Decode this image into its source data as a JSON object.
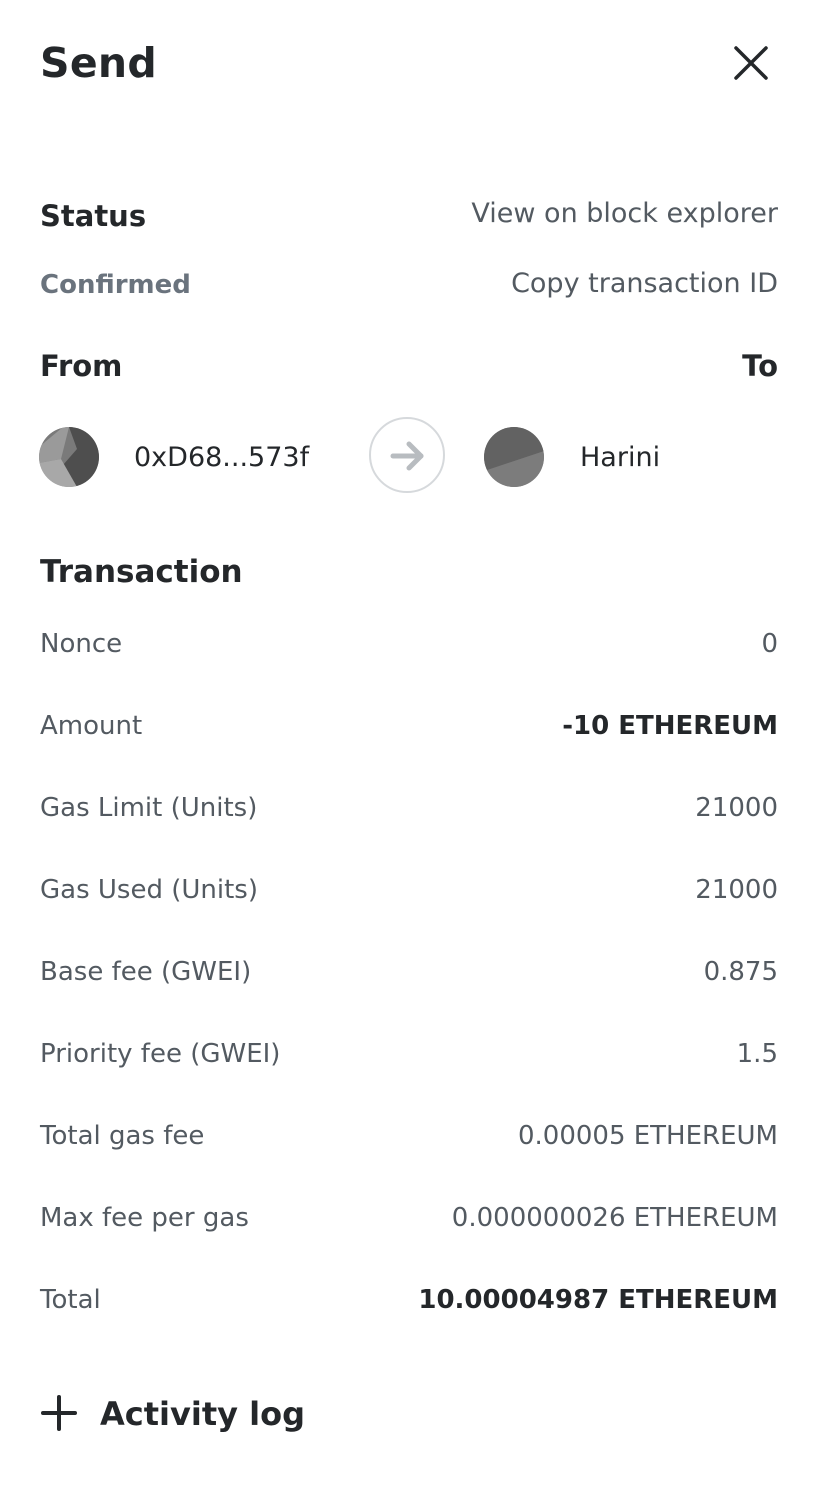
{
  "header": {
    "title": "Send"
  },
  "status": {
    "label": "Status",
    "value": "Confirmed",
    "view_explorer": "View on block explorer",
    "copy_tx_id": "Copy transaction ID"
  },
  "parties": {
    "from_label": "From",
    "to_label": "To",
    "from_address": "0xD68...573f",
    "to_name": "Harini"
  },
  "transaction": {
    "title": "Transaction",
    "rows": [
      {
        "label": "Nonce",
        "value": "0"
      },
      {
        "label": "Amount",
        "value": "-10 ETHEREUM"
      },
      {
        "label": "Gas Limit (Units)",
        "value": "21000"
      },
      {
        "label": "Gas Used (Units)",
        "value": "21000"
      },
      {
        "label": "Base fee (GWEI)",
        "value": "0.875"
      },
      {
        "label": "Priority fee (GWEI)",
        "value": "1.5"
      },
      {
        "label": "Total gas fee",
        "value": "0.00005 ETHEREUM"
      },
      {
        "label": "Max fee per gas",
        "value": "0.000000026 ETHEREUM"
      },
      {
        "label": "Total",
        "value": "10.00004987 ETHEREUM"
      }
    ]
  },
  "activity": {
    "label": "Activity log"
  },
  "icons": {
    "close": "close-icon",
    "arrow": "arrow-right-icon",
    "plus": "plus-icon"
  },
  "colors": {
    "text_primary": "#24272a",
    "text_secondary": "#535a61",
    "status_confirmed": "#6a737d"
  }
}
